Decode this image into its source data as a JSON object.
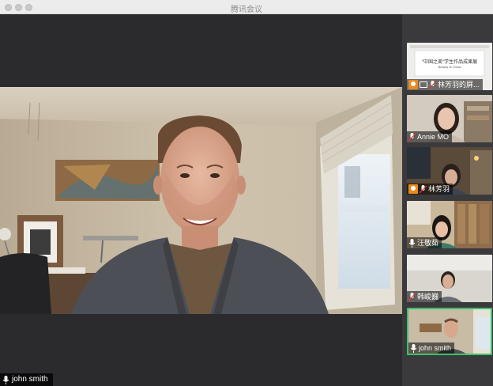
{
  "window": {
    "title": "腾讯会议"
  },
  "main": {
    "speaker_name": "john smith"
  },
  "share": {
    "line1": "\"中国之美\"学生作品成果展",
    "line2": "Beauty of China"
  },
  "participants": [
    {
      "name": "林芳羽的屏...",
      "badge": "host",
      "type": "screen-share"
    },
    {
      "name": "Annie MO"
    },
    {
      "name": "林芳羽",
      "badge": "host"
    },
    {
      "name": "汪敬茹"
    },
    {
      "name": "韩峻巍"
    },
    {
      "name": "john smith",
      "active": true
    }
  ],
  "colors": {
    "active_border": "#3fbf6b",
    "host_badge": "#e98a1e",
    "sidebar_bg": "#3a3a3c",
    "stage_bg": "#2b2b2d"
  }
}
